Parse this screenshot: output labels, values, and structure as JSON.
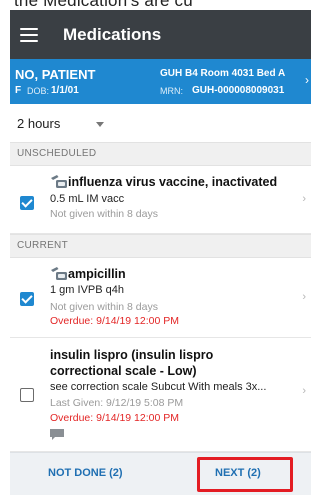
{
  "top_cropped_text": "the Medication's are cu",
  "app_bar": {
    "menu_icon": "hamburger-menu-icon",
    "title": "Medications"
  },
  "patient": {
    "name": "NO, PATIENT",
    "sex": "F",
    "dob_label": "DOB:",
    "dob": "1/1/01",
    "location": "GUH B4 Room 4031 Bed A",
    "mrn_label": "MRN:",
    "mrn": "GUH-000008009031",
    "chevron": "›"
  },
  "time_filter": {
    "selected": "2 hours",
    "caret_icon": "dropdown-caret-icon"
  },
  "sections": {
    "unscheduled": "UNSCHEDULED",
    "current": "CURRENT"
  },
  "medications": [
    {
      "name": "influenza virus vaccine, inactivated",
      "dose": "0.5 mL IM vacc",
      "status": "Not given within 8 days",
      "checked": true,
      "icon": "syringe-transfer-icon"
    },
    {
      "name": "ampicillin",
      "dose": "1 gm IVPB q4h",
      "status": "Not given within 8 days",
      "overdue": "Overdue: 9/14/19 12:00 PM",
      "checked": true,
      "icon": "syringe-transfer-icon"
    },
    {
      "name_line1": "insulin lispro (insulin lispro",
      "name_line2": "correctional scale - Low)",
      "dose": "see correction scale Subcut With meals 3x...",
      "status": "Last Given: 9/12/19 5:08 PM",
      "overdue": "Overdue: 9/14/19 12:00 PM",
      "checked": false,
      "icon": "comment-icon"
    }
  ],
  "footer": {
    "not_done": "NOT DONE (2)",
    "next": "NEXT (2)"
  },
  "colors": {
    "app_bar": "#3a3f44",
    "patient_banner": "#1f88d0",
    "checkbox": "#1f88d0",
    "overdue": "#e32626",
    "highlight_box": "#e31c23",
    "footer_text": "#1f6fb2"
  }
}
